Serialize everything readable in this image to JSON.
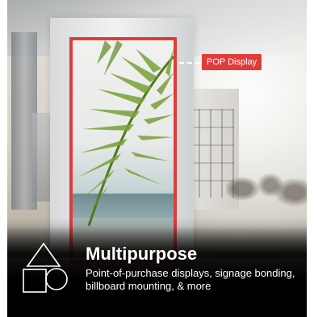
{
  "callout": {
    "label": "POP Display",
    "accent": "#e23b3b"
  },
  "feature": {
    "icon": "shapes-icon",
    "title": "Multipurpose",
    "description": "Point-of-purchase displays, signage bonding, billboard mounting, & more"
  },
  "colors": {
    "background": "#000000",
    "text": "#ffffff",
    "accent": "#e23b3b"
  }
}
